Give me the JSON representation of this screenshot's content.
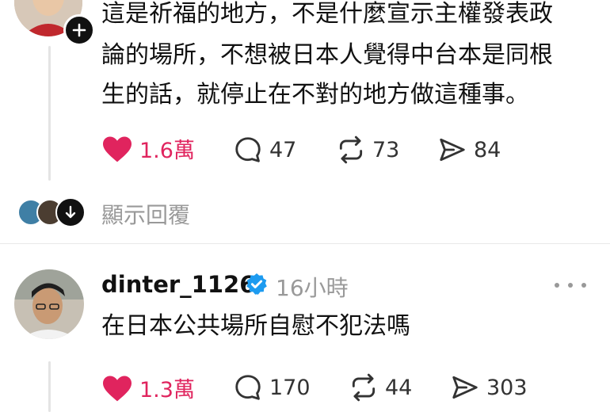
{
  "post1": {
    "text_lines": [
      "這是祈福的地方，不是什麼宣示主權發表政",
      "論的場所，不想被日本人覺得中台本是同根",
      "生的話，就停止在不對的地方做這種事。"
    ],
    "likes": "1.6萬",
    "comments": "47",
    "reposts": "73",
    "shares": "84",
    "show_replies_label": "顯示回覆"
  },
  "post2": {
    "username": "dinter_1126",
    "time": "16小時",
    "text": "在日本公共場所自慰不犯法嗎",
    "likes": "1.3萬",
    "comments": "170",
    "reposts": "44",
    "shares": "303"
  },
  "colors": {
    "like": "#e0245e",
    "verified": "#1d9bf0",
    "text": "#111111",
    "muted": "#999999"
  }
}
